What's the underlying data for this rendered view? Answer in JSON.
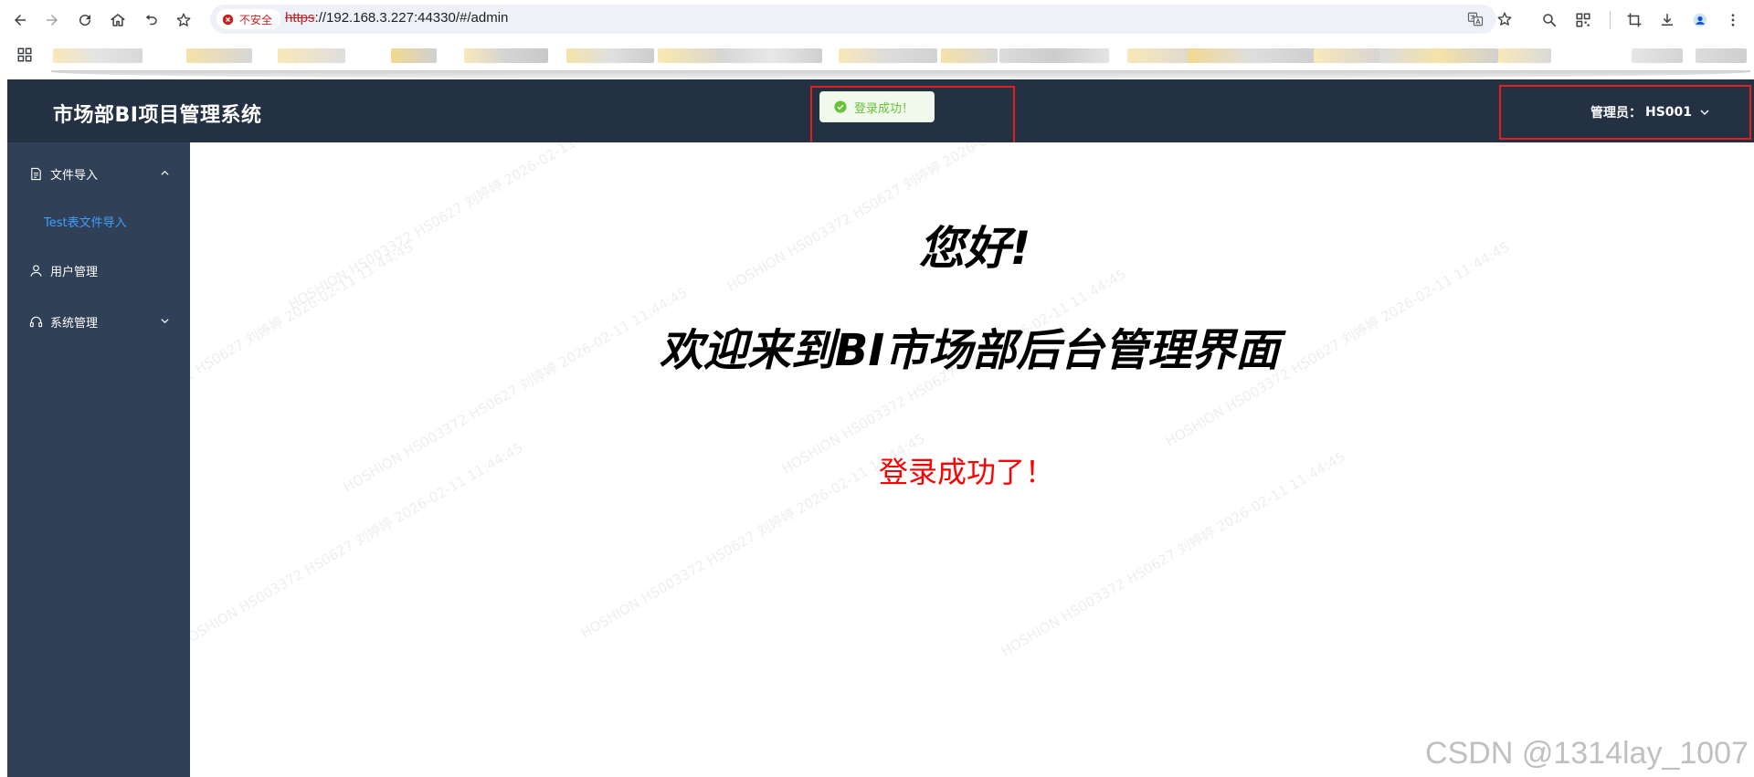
{
  "browser": {
    "security_label": "不安全",
    "url_scheme": "https",
    "url_rest": "://192.168.3.227:44330/#/admin"
  },
  "header": {
    "title": "市场部BI项目管理系统",
    "user_label": "管理员：",
    "user_name": "HS001"
  },
  "toast": {
    "message": "登录成功！",
    "color": "#67c23a"
  },
  "sidebar": {
    "background": "#304056",
    "items": [
      {
        "label": "文件导入",
        "icon": "document-icon",
        "expanded": true
      },
      {
        "label": "Test表文件导入",
        "active": true
      },
      {
        "label": "用户管理",
        "icon": "user-icon"
      },
      {
        "label": "系统管理",
        "icon": "headset-icon",
        "expanded": false
      }
    ]
  },
  "main": {
    "greeting": "您好!",
    "welcome": "欢迎来到BI市场部后台管理界面",
    "status_message": "登录成功了！"
  },
  "watermark": {
    "text": "HOSHION HS003372 HS0627 刘婷婷 2026-02-11 11:44:45"
  },
  "credit": {
    "text": "CSDN @1314lay_1007"
  },
  "colors": {
    "header_bg": "#243143",
    "accent": "#409eff",
    "highlight_box": "#e02020",
    "status_red": "#ff0000"
  }
}
